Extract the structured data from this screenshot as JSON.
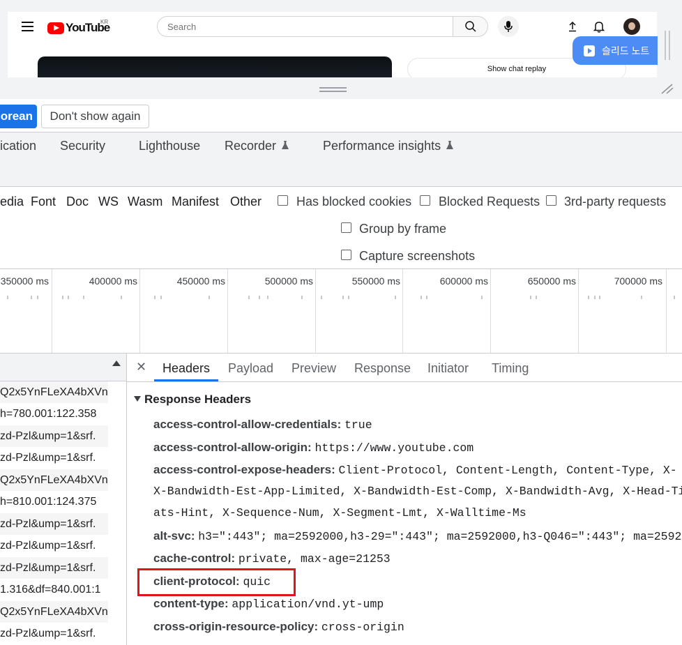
{
  "youtube": {
    "logo_text": "YouTube",
    "region": "KR",
    "search_placeholder": "Search",
    "chat_replay": "Show chat replay",
    "slide_note": "슬리드 노트"
  },
  "infobar": {
    "switch_button": "orean",
    "dont_show_button": "Don't show again"
  },
  "main_tabs": [
    "ication",
    "Security",
    "Lighthouse",
    "Recorder",
    "Performance insights"
  ],
  "filter_types": [
    "edia",
    "Font",
    "Doc",
    "WS",
    "Wasm",
    "Manifest",
    "Other"
  ],
  "filter_checkboxes": [
    "Has blocked cookies",
    "Blocked Requests",
    "3rd-party requests"
  ],
  "settings": {
    "group_by_frame": "Group by frame",
    "capture_screenshots": "Capture screenshots"
  },
  "timeline_labels": [
    "350000 ms",
    "400000 ms",
    "450000 ms",
    "500000 ms",
    "550000 ms",
    "600000 ms",
    "650000 ms",
    "700000 ms"
  ],
  "requests": [
    "Q2x5YnFLeXA4bXVn",
    "h=780.001:122.358",
    "zd-Pzl&ump=1&srf.",
    "zd-Pzl&ump=1&srf.",
    "Q2x5YnFLeXA4bXVn",
    "h=810.001:124.375",
    "zd-Pzl&ump=1&srf.",
    "zd-Pzl&ump=1&srf.",
    "zd-Pzl&ump=1&srf.",
    "1.316&df=840.001:1",
    "Q2x5YnFLeXA4bXVn",
    "zd-Pzl&ump=1&srf."
  ],
  "detail_tabs": [
    "Headers",
    "Payload",
    "Preview",
    "Response",
    "Initiator",
    "Timing"
  ],
  "response_headers": {
    "title": "Response Headers",
    "items": [
      {
        "key": "access-control-allow-credentials:",
        "value": "true"
      },
      {
        "key": "access-control-allow-origin:",
        "value": "https://www.youtube.com"
      },
      {
        "key": "access-control-expose-headers:",
        "value": "Client-Protocol, Content-Length, Content-Type, X-"
      },
      {
        "key": "alt-svc:",
        "value": "h3=\":443\"; ma=2592000,h3-29=\":443\"; ma=2592000,h3-Q046=\":443\"; ma=2592"
      },
      {
        "key": "cache-control:",
        "value": "private, max-age=21253"
      },
      {
        "key": "client-protocol:",
        "value": "quic"
      },
      {
        "key": "content-type:",
        "value": "application/vnd.yt-ump"
      },
      {
        "key": "cross-origin-resource-policy:",
        "value": "cross-origin"
      }
    ],
    "expose_continuation": [
      "X-Bandwidth-Est-App-Limited, X-Bandwidth-Est-Comp, X-Bandwidth-Avg, X-Head-Ti",
      "ats-Hint, X-Sequence-Num, X-Segment-Lmt, X-Walltime-Ms"
    ]
  }
}
